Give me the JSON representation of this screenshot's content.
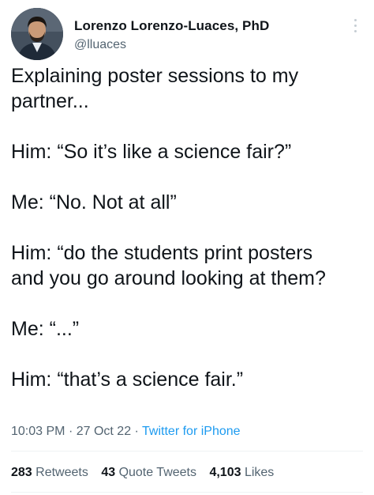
{
  "author": {
    "display_name": "Lorenzo Lorenzo-Luaces, PhD",
    "handle": "@lluaces",
    "avatar_icon": "profile-photo"
  },
  "tweet": {
    "lines": [
      "Explaining poster sessions to my",
      "partner...",
      "",
      "Him: “So it’s like a science fair?”",
      "",
      "Me: “No. Not at all”",
      "",
      "Him: “do the students print posters",
      "and you go around looking at them?",
      "",
      "Me: “...”",
      "",
      "Him: “that’s a science fair.”"
    ]
  },
  "meta": {
    "time": "10:03 PM",
    "separator": "·",
    "date": "27 Oct 22",
    "source": "Twitter for iPhone"
  },
  "stats": {
    "retweets_count": "283",
    "retweets_label": "Retweets",
    "quotes_count": "43",
    "quotes_label": "Quote Tweets",
    "likes_count": "4,103",
    "likes_label": "Likes"
  },
  "colors": {
    "text": "#0f1419",
    "secondary": "#536471",
    "link": "#1d9bf0",
    "divider": "#eff3f4"
  }
}
